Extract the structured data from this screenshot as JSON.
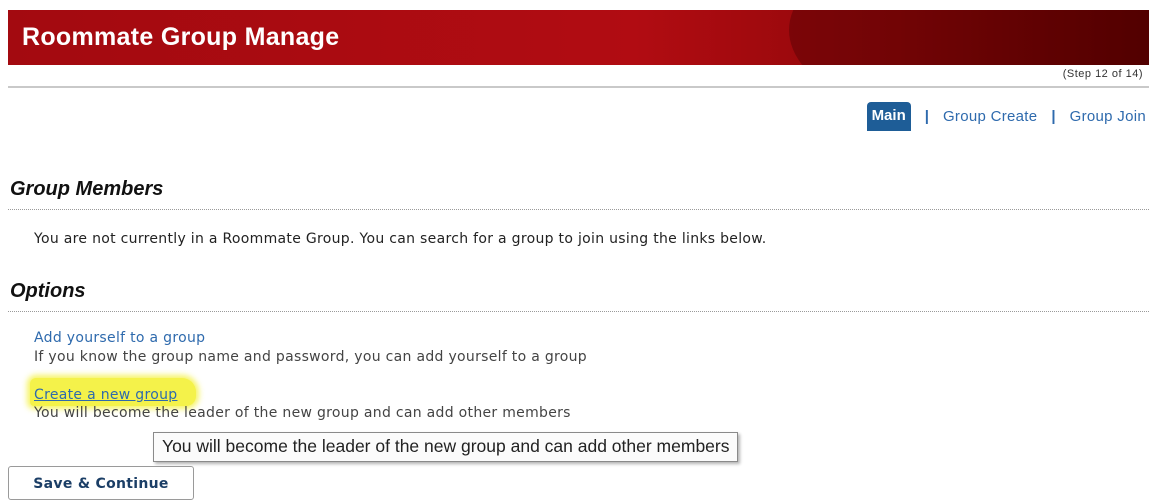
{
  "header": {
    "title": "Roommate Group Manage",
    "step": "(Step 12 of 14)"
  },
  "tabs": {
    "main": "Main",
    "separator": "|",
    "group_create": "Group Create",
    "group_join": "Group Join"
  },
  "group_members": {
    "title": "Group Members",
    "message": "You are not currently in a Roommate Group. You can search for a group to join using the links below."
  },
  "options": {
    "title": "Options",
    "items": [
      {
        "label": "Add yourself to a group",
        "description": "If you know the group name and password, you can add yourself to a group"
      },
      {
        "label": "Create a new group",
        "description": "You will become the leader of the new group and can add other members"
      }
    ]
  },
  "tooltip": {
    "text": "You will become the leader of the new group and can add other members"
  },
  "actions": {
    "save_continue": "Save & Continue"
  },
  "colors": {
    "header_red": "#a30a10",
    "active_tab": "#1e5d97",
    "link_blue": "#2e6aad",
    "highlight_yellow": "#f4f24a"
  }
}
